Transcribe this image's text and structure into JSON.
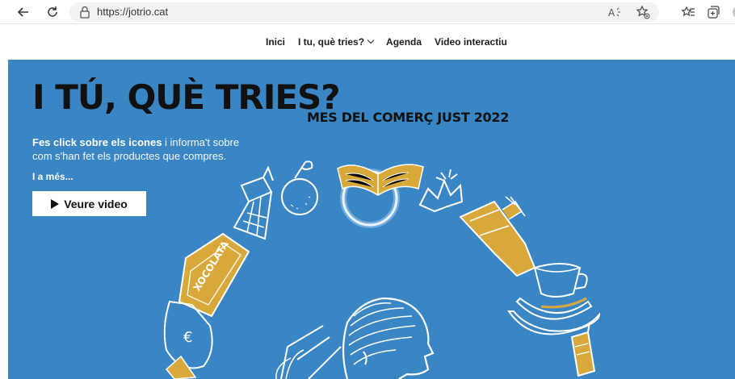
{
  "browser": {
    "url": "https://jotrio.cat",
    "icons": [
      "back-icon",
      "reload-icon",
      "lock-icon",
      "read-aloud-icon",
      "favorite-add-icon",
      "favorites-icon",
      "collections-icon",
      "profile-icon"
    ]
  },
  "nav": {
    "items": [
      {
        "label": "Inici"
      },
      {
        "label": "I tu, què tries?"
      },
      {
        "label": "Agenda"
      },
      {
        "label": "Video interactiu"
      }
    ]
  },
  "hero": {
    "title": "I TÚ, QUÈ TRIES?",
    "subtitle": "MES DEL COMERÇ JUST 2022",
    "intro_bold": "Fes click sobre els icones",
    "intro_rest": " i informa't sobre com s'han fet els productes que compres.",
    "more": "I a més...",
    "button": "Veure video",
    "chocolate_label": "XOCOLATA",
    "coin_label": "€",
    "colors": {
      "background": "#3a86c4",
      "accent": "#d9a83a",
      "line": "#ffffff"
    }
  }
}
